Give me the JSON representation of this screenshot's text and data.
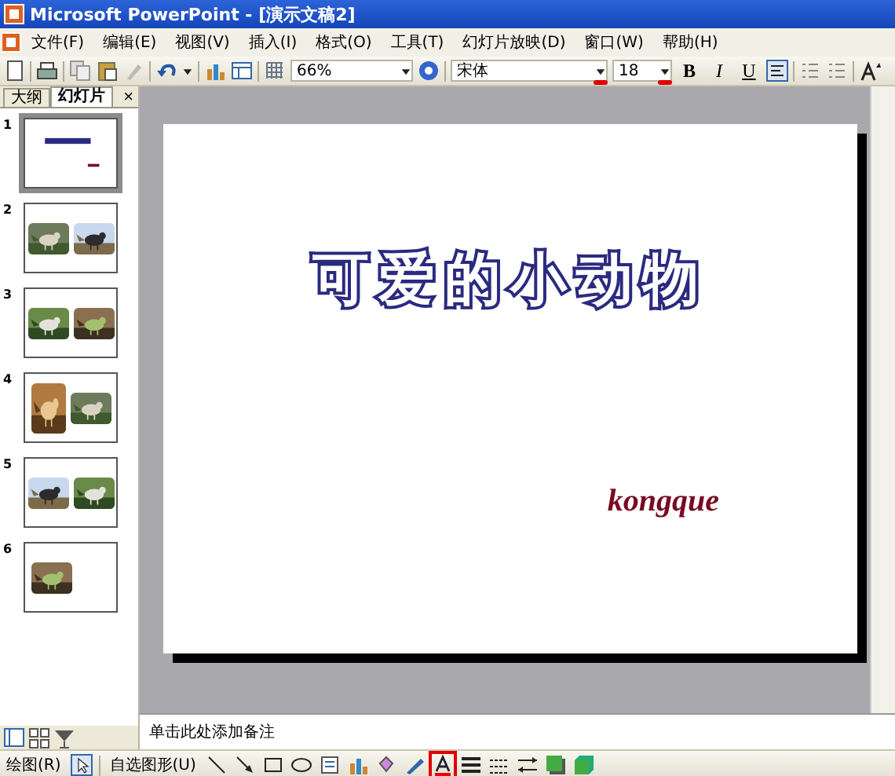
{
  "window": {
    "title": "Microsoft PowerPoint - [演示文稿2]"
  },
  "menu": [
    "文件(F)",
    "编辑(E)",
    "视图(V)",
    "插入(I)",
    "格式(O)",
    "工具(T)",
    "幻灯片放映(D)",
    "窗口(W)",
    "帮助(H)"
  ],
  "toolbar": {
    "zoom": "66%",
    "font": "宋体",
    "font_size": "18",
    "format_buttons": [
      "B",
      "I",
      "U"
    ]
  },
  "panel": {
    "tabs": [
      {
        "label": "大纲",
        "selected": false
      },
      {
        "label": "幻灯片",
        "selected": true
      }
    ],
    "close": "×",
    "slides": [
      {
        "number": "1",
        "selected": true,
        "kind": "title"
      },
      {
        "number": "2",
        "selected": false,
        "kind": "pictures"
      },
      {
        "number": "3",
        "selected": false,
        "kind": "pictures"
      },
      {
        "number": "4",
        "selected": false,
        "kind": "pictures"
      },
      {
        "number": "5",
        "selected": false,
        "kind": "pictures"
      },
      {
        "number": "6",
        "selected": false,
        "kind": "single"
      }
    ]
  },
  "slide": {
    "title": "可爱的小动物",
    "subtitle": "kongque"
  },
  "notes": {
    "placeholder": "单击此处添加备注"
  },
  "drawing_toolbar": {
    "draw_menu": "绘图(R)",
    "autoshapes_menu": "自选图形(U)"
  }
}
